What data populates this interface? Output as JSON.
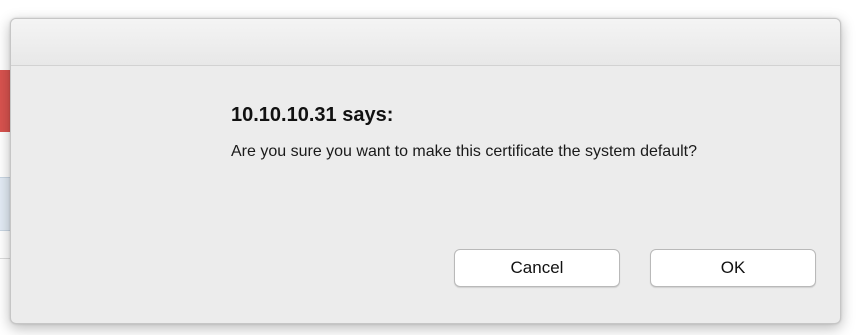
{
  "dialog": {
    "heading": "10.10.10.31 says:",
    "message": "Are you sure you want to make this certificate the system default?",
    "buttons": {
      "cancel_label": "Cancel",
      "ok_label": "OK"
    }
  },
  "colors": {
    "dialog_background": "#ececec",
    "button_background": "#ffffff",
    "background_accent_red": "#d9534f",
    "background_accent_blue": "#e3ecf5"
  }
}
